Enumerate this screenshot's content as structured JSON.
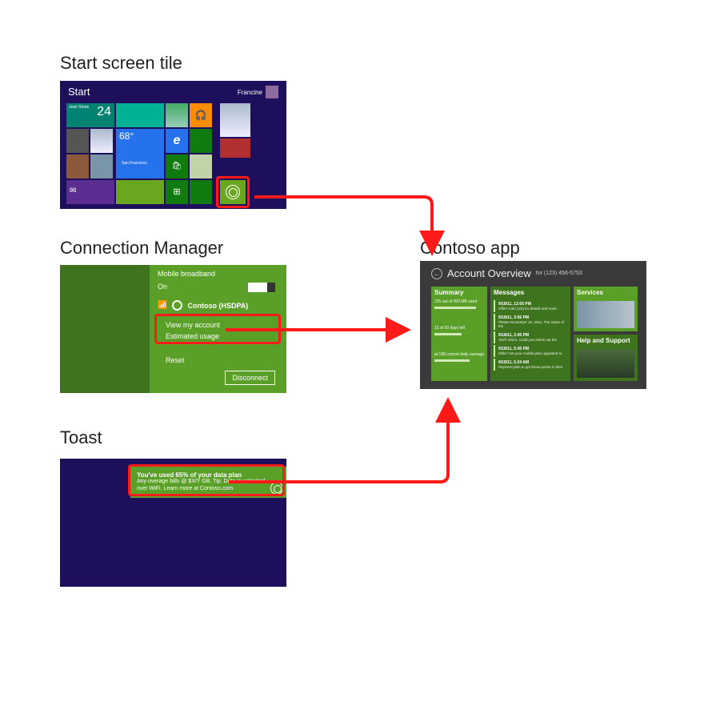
{
  "labels": {
    "start": "Start screen tile",
    "cm": "Connection Manager",
    "toast": "Toast",
    "app": "Contoso app"
  },
  "start": {
    "title": "Start",
    "user_name": "Francine",
    "weather_temp": "68°",
    "weather_city": "San Francisco",
    "calendar_day": "24",
    "calendar_name": "Jean Stone"
  },
  "cm": {
    "header": "Mobile broadband",
    "toggle_label": "On",
    "network": "Contoso (HSDPA)",
    "link_account": "View my account",
    "link_usage": "Estimated usage",
    "link_reset": "Reset",
    "disconnect": "Disconnect"
  },
  "toast": {
    "title": "You've used 65% of your data plan",
    "body": "Any overage bills @ $X/Y GB. Tip: Data is unlimited over WiFi. Learn more at Contoso.com"
  },
  "app": {
    "title": "Account Overview",
    "phone": "for (123) 456-5753",
    "cards": {
      "summary": "Summary",
      "messages": "Messages",
      "services": "Services",
      "help": "Help and Support"
    },
    "summary": {
      "line1": "225 out of 300 MB used",
      "line2": "15 of 30 days left",
      "line3": "at 198 current daily average"
    },
    "messages": [
      {
        "t": "9/18/11, 12:05 PM",
        "b": "Offer! Call (123) for details and more"
      },
      {
        "t": "9/18/11, 3:56 PM",
        "b": "Please November 10, 2011. The name of the"
      },
      {
        "t": "9/18/11, 3:45 PM",
        "b": "Yes'll return, could you check out the"
      },
      {
        "t": "9/18/11, 5:45 PM",
        "b": "Offer! Get your mobile plan upgraded to"
      },
      {
        "t": "9/18/11, 5:24 AM",
        "b": "Payment plan to get those points in then"
      }
    ]
  }
}
